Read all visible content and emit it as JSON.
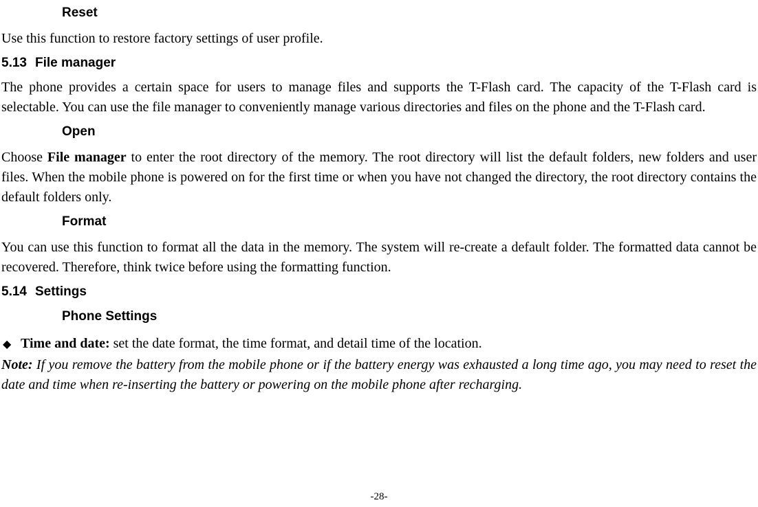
{
  "headings": {
    "reset": "Reset",
    "file_manager": "File manager",
    "open": "Open",
    "format": "Format",
    "settings": "Settings",
    "phone_settings": "Phone Settings"
  },
  "section_numbers": {
    "file_manager": "5.13",
    "settings": "5.14"
  },
  "paragraphs": {
    "reset_body": "Use this function to restore factory settings of user profile.",
    "file_manager_body": "The phone provides a certain space for users to manage files and supports the T-Flash card. The capacity of the T-Flash card is selectable. You can use the file manager to conveniently manage various directories and files on the phone and the T-Flash card.",
    "open_prefix": "Choose ",
    "open_bold": "File manager",
    "open_suffix": " to enter the root directory of the memory. The root directory will list the default folders, new folders and user files. When the mobile phone is powered on for the first time or when you have not changed the directory, the root directory contains the default folders only.",
    "format_body": "You can use this function to format all the data in the memory. The system will re-create a default folder. The formatted data cannot be recovered. Therefore, think twice before using the formatting function."
  },
  "bullets": {
    "time_date_label": "Time and date:",
    "time_date_text": " set the date format, the time format, and detail time of the location."
  },
  "note": {
    "label": "Note:",
    "text": " If you remove the battery from the mobile phone or if the battery energy was exhausted a long time ago, you may need to reset the date and time when re-inserting the battery or powering on the mobile phone after recharging."
  },
  "page_number": "-28-"
}
